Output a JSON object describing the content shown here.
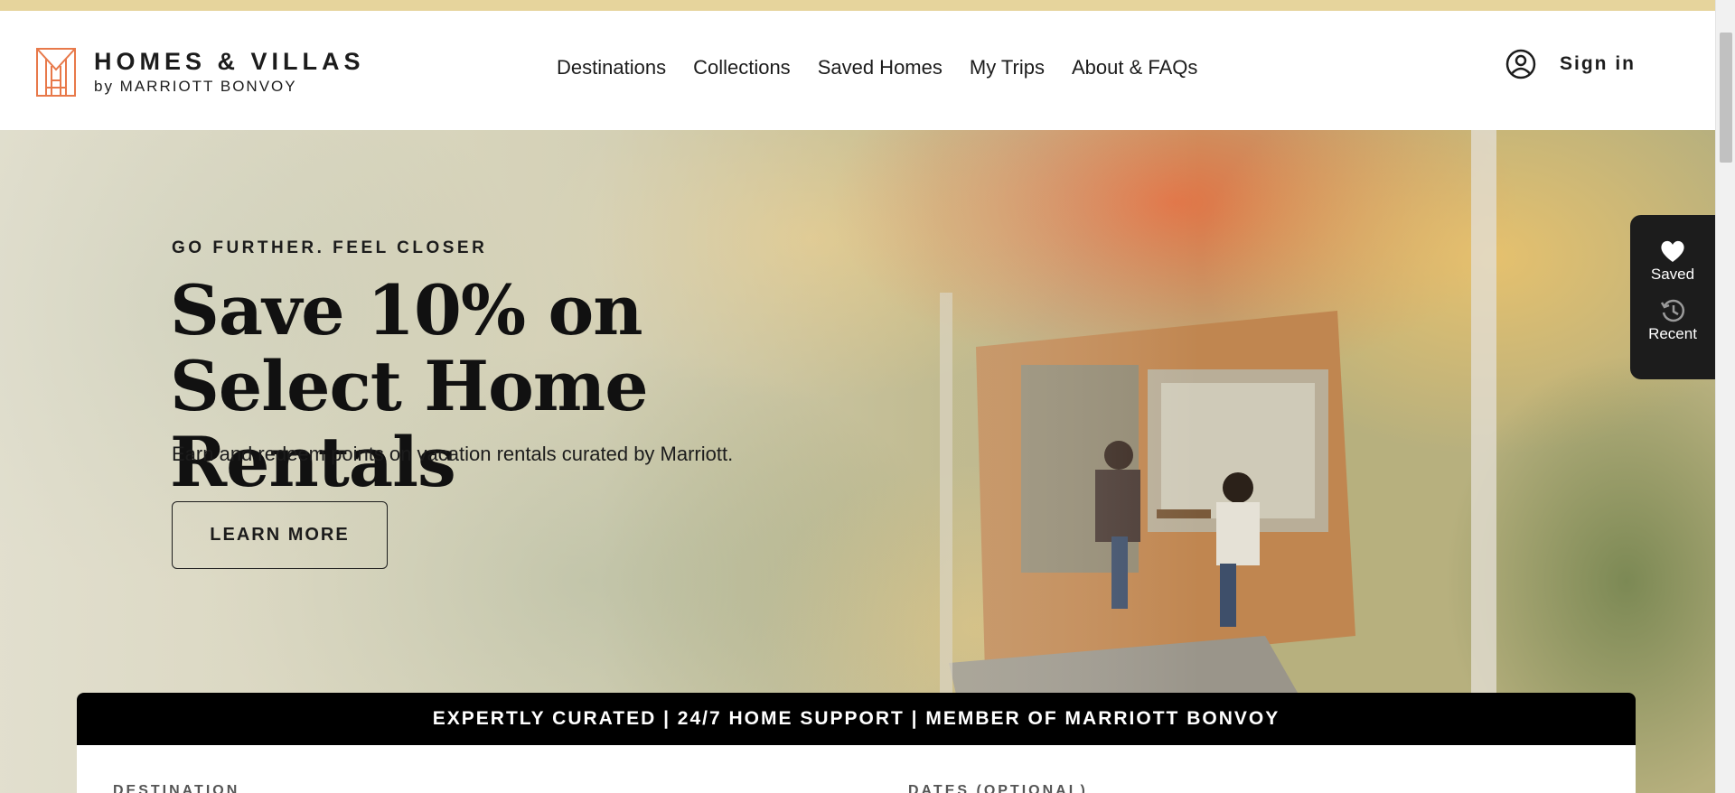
{
  "brand": {
    "logo_main": "HOMES & VILLAS",
    "logo_sub": "by MARRIOTT BONVOY"
  },
  "nav": {
    "items": [
      {
        "label": "Destinations"
      },
      {
        "label": "Collections"
      },
      {
        "label": "Saved Homes"
      },
      {
        "label": "My Trips"
      },
      {
        "label": "About & FAQs"
      }
    ],
    "signin_label": "Sign in"
  },
  "hero": {
    "eyebrow": "GO FURTHER. FEEL CLOSER",
    "headline": "Save 10% on Select Home Rentals",
    "subtext": "Earn and redeem points on vacation rentals curated by Marriott.",
    "cta_label": "LEARN MORE"
  },
  "side_widget": {
    "saved_label": "Saved",
    "recent_label": "Recent"
  },
  "search": {
    "usp_text": "EXPERTLY CURATED | 24/7 HOME SUPPORT | MEMBER OF MARRIOTT BONVOY",
    "destination_label": "DESTINATION",
    "dates_label": "DATES (OPTIONAL)"
  },
  "colors": {
    "accent_strip": "#e6d49c",
    "logo_orange": "#e8794a",
    "text_dark": "#1c1c1c"
  }
}
